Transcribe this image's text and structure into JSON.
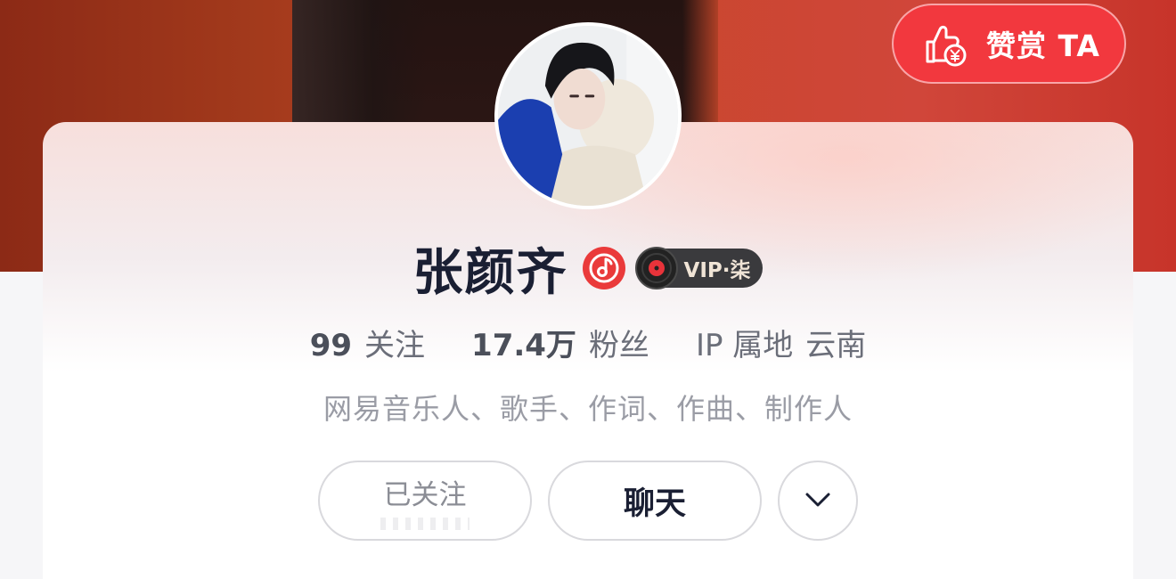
{
  "header": {
    "reward_button_label": "赞赏 TA"
  },
  "profile": {
    "name": "张颜齐",
    "vip_label": "VIP·柒",
    "stats": {
      "following_count": "99",
      "following_label": "关注",
      "followers_count": "17.4万",
      "followers_label": "粉丝",
      "ip_label": "IP 属地",
      "ip_value": "云南"
    },
    "bio": "网易音乐人、歌手、作词、作曲、制作人"
  },
  "actions": {
    "followed_label": "已关注",
    "chat_label": "聊天"
  },
  "colors": {
    "accent": "#f2383e",
    "name": "#1a1f33",
    "vip_bg": "#3a3a3d"
  },
  "icons": {
    "reward": "thumbs-up-yen-icon",
    "musician": "music-note-icon",
    "vip": "vinyl-disc-icon",
    "more": "chevron-down-icon"
  }
}
